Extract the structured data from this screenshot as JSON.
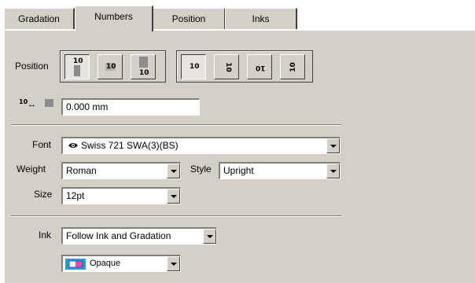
{
  "tabs": [
    {
      "label": "Gradation"
    },
    {
      "label": "Numbers"
    },
    {
      "label": "Position"
    },
    {
      "label": "Inks"
    }
  ],
  "active_tab": "Numbers",
  "position": {
    "label": "Position",
    "group1_numeral": "10",
    "group2_numeral": "10"
  },
  "offset": {
    "icon_label": "10",
    "value": "0.000 mm"
  },
  "font": {
    "label": "Font",
    "value": "Swiss 721 SWA(3)(BS)"
  },
  "weight": {
    "label": "Weight",
    "value": "Roman"
  },
  "style": {
    "label": "Style",
    "value": "Upright"
  },
  "size": {
    "label": "Size",
    "value": "12pt"
  },
  "ink": {
    "label": "Ink",
    "value": "Follow Ink and Gradation",
    "opacity_value": "Opaque"
  }
}
